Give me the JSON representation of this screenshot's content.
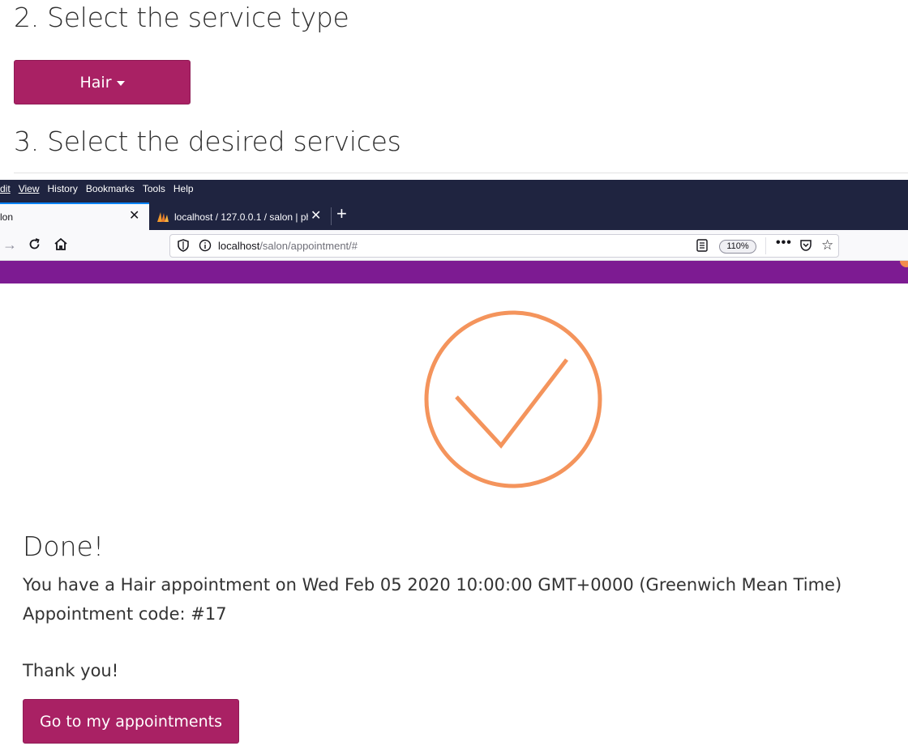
{
  "page": {
    "step2_heading": "2. Select the service type",
    "service_type_selected": "Hair",
    "step3_heading": "3. Select the desired services"
  },
  "browser": {
    "menu": [
      "dit",
      "View",
      "History",
      "Bookmarks",
      "Tools",
      "Help"
    ],
    "tabs": [
      {
        "title": "lon",
        "active": true
      },
      {
        "title": "localhost / 127.0.0.1 / salon | ph",
        "active": false
      }
    ],
    "url_host": "localhost",
    "url_path": "/salon/appointment/#",
    "zoom": "110%"
  },
  "confirmation": {
    "title": "Done!",
    "message": "You have a Hair appointment on Wed Feb 05 2020 10:00:00 GMT+0000 (Greenwich Mean Time)",
    "code": "Appointment code: #17",
    "thanks": "Thank you!",
    "button_label": "Go to my appointments"
  },
  "colors": {
    "primary_button": "#a92164",
    "header_purple": "#7d1b92",
    "check_orange": "#f4945c",
    "browser_dark": "#1f2440"
  },
  "icons": [
    "caret-down-icon",
    "close-icon",
    "plus-icon",
    "back-arrow-icon",
    "reload-icon",
    "home-icon",
    "shield-icon",
    "info-icon",
    "reader-view-icon",
    "more-icon",
    "pocket-icon",
    "star-icon",
    "checkmark-circle-icon"
  ]
}
